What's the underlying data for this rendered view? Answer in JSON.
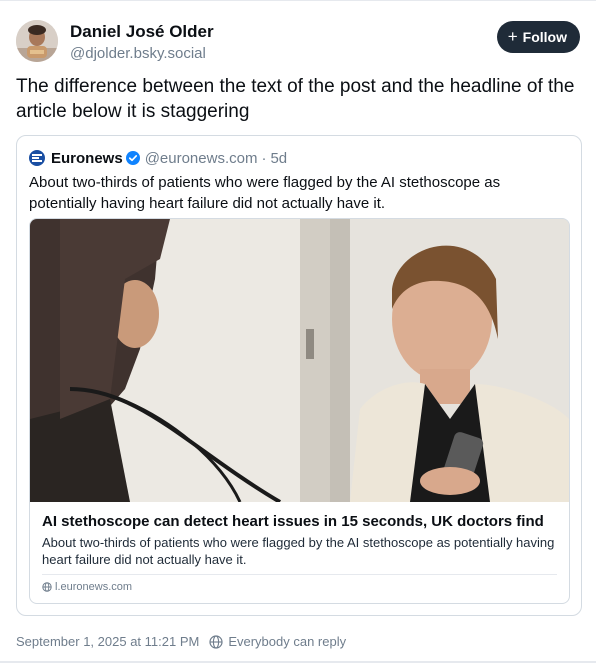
{
  "author": {
    "name": "Daniel José Older",
    "handle": "@djolder.bsky.social"
  },
  "follow_button": {
    "label": "Follow",
    "icon": "plus-icon"
  },
  "post": {
    "text": "The difference between the text of the post and the headline of the article below it is staggering"
  },
  "quoted_post": {
    "source_name": "Euronews",
    "source_handle": "@euronews.com",
    "separator": "·",
    "time_ago": "5d",
    "text": "About two-thirds of patients who were flagged by the AI stethoscope as potentially having heart failure did not actually have it.",
    "link_card": {
      "title": "AI stethoscope can detect heart issues in 15 seconds, UK doctors find",
      "description": "About two-thirds of patients who were flagged by the AI stethoscope as potentially having heart failure did not actually have it.",
      "domain": "l.euronews.com"
    }
  },
  "footer": {
    "timestamp": "September 1, 2025 at 11:21 PM",
    "reply_permission": "Everybody can reply"
  },
  "colors": {
    "follow_bg": "#1f2b38",
    "muted_text": "#6f7d8c",
    "border": "#d4dbe2",
    "verified_blue": "#1083fe"
  }
}
